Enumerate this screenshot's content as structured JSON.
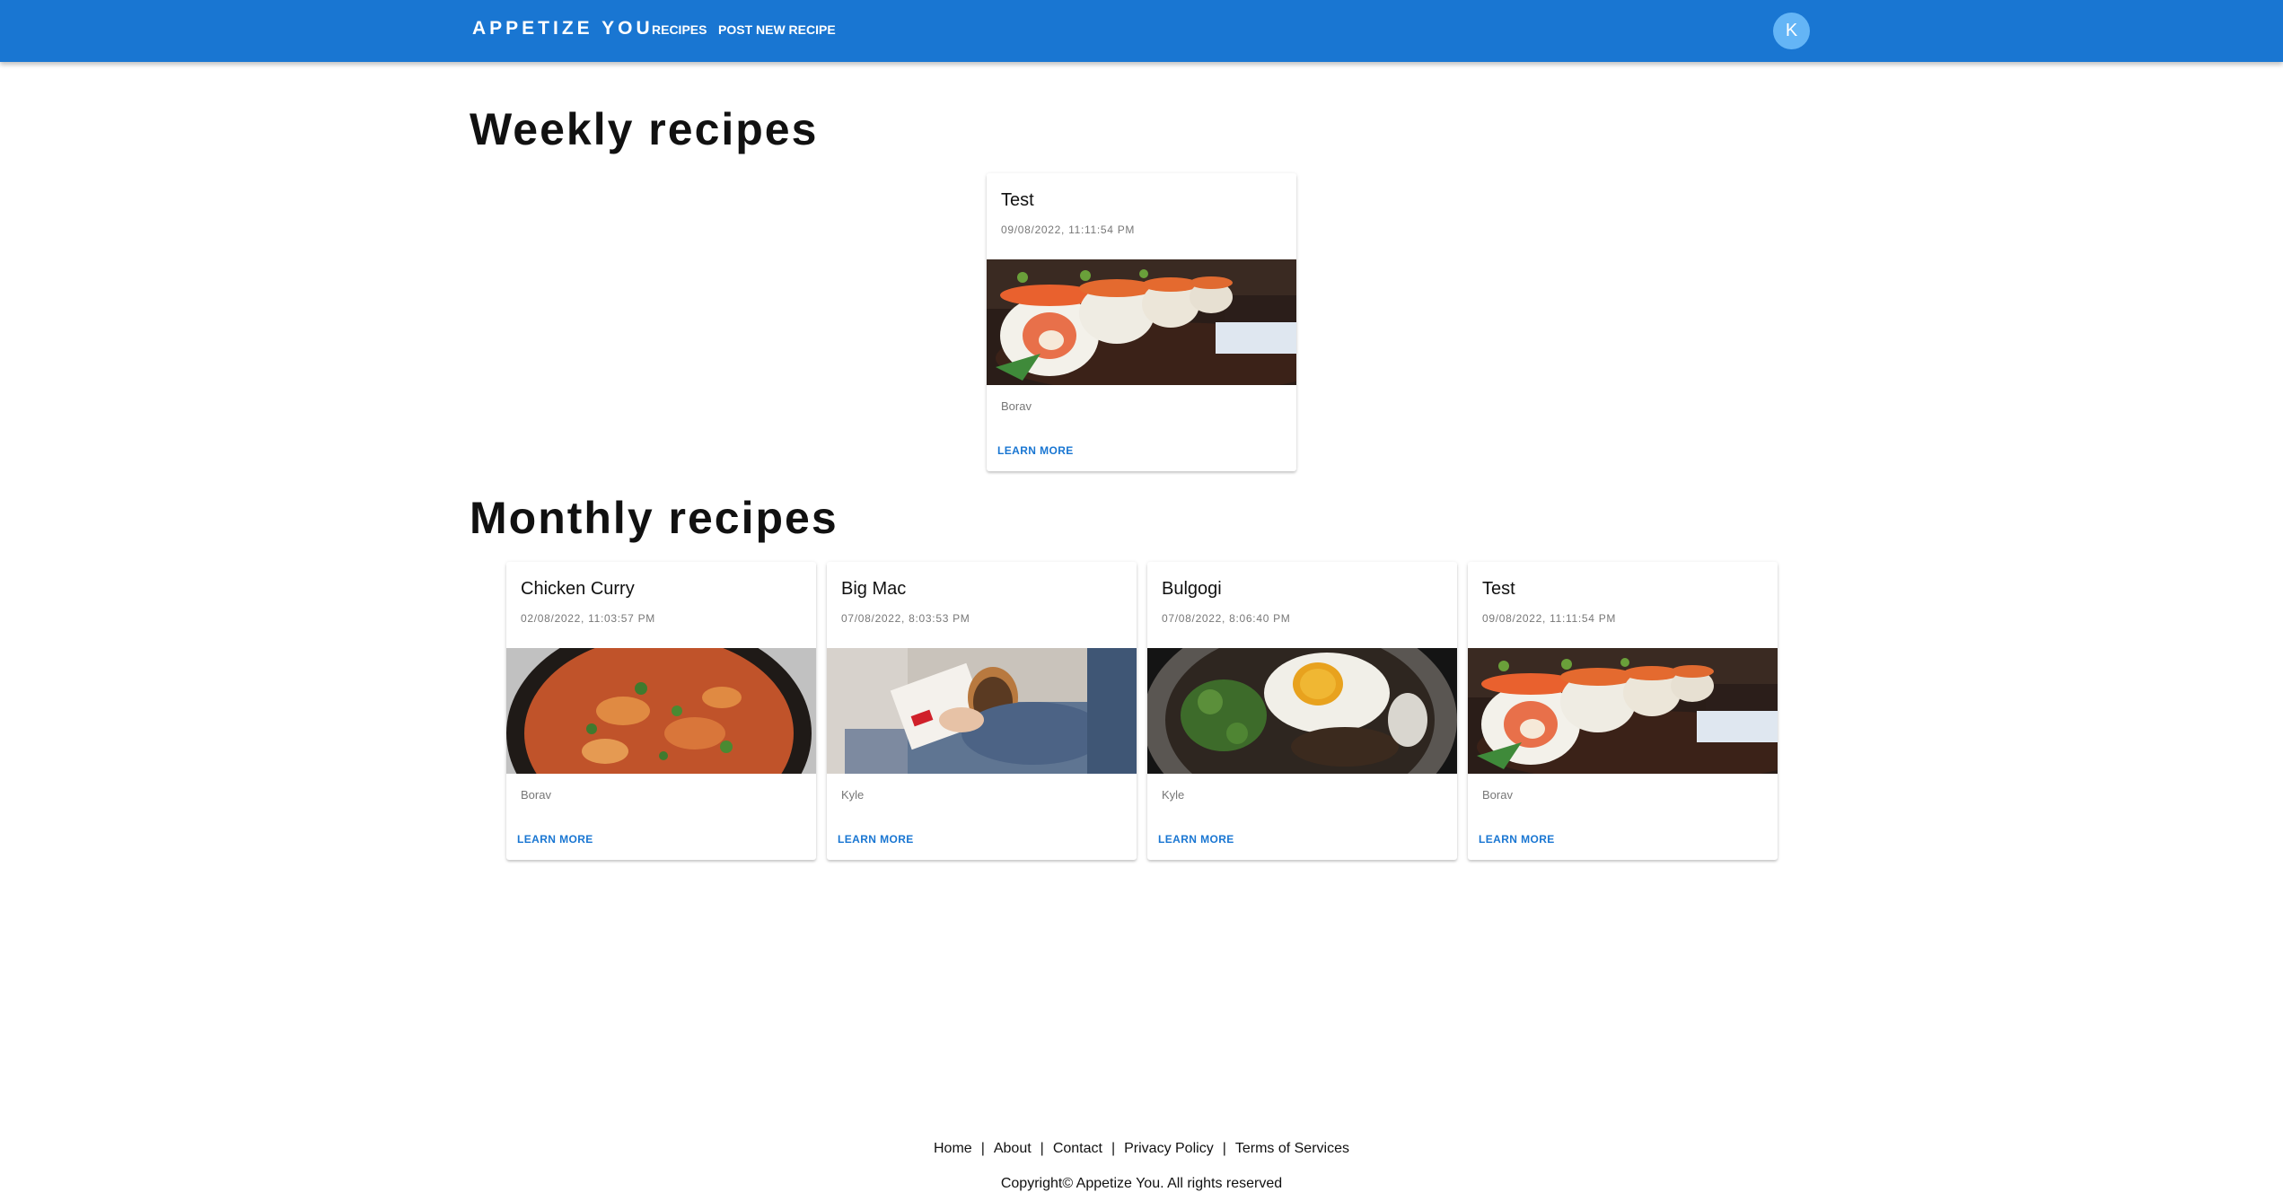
{
  "header": {
    "brand": "APPETIZE YOU",
    "nav": [
      "RECIPES",
      "POST NEW RECIPE"
    ],
    "avatar_initial": "K"
  },
  "weekly": {
    "title": "Weekly recipes",
    "cards": [
      {
        "title": "Test",
        "date": "09/08/2022, 11:11:54 PM",
        "author": "Borav",
        "action": "LEARN MORE",
        "image": "sushi-rolls-photo"
      }
    ]
  },
  "monthly": {
    "title": "Monthly recipes",
    "cards": [
      {
        "title": "Chicken Curry",
        "date": "02/08/2022, 11:03:57 PM",
        "author": "Borav",
        "action": "LEARN MORE",
        "image": "chicken-curry-photo"
      },
      {
        "title": "Big Mac",
        "date": "07/08/2022, 8:03:53 PM",
        "author": "Kyle",
        "action": "LEARN MORE",
        "image": "burger-box-photo"
      },
      {
        "title": "Bulgogi",
        "date": "07/08/2022, 8:06:40 PM",
        "author": "Kyle",
        "action": "LEARN MORE",
        "image": "bulgogi-bowl-photo"
      },
      {
        "title": "Test",
        "date": "09/08/2022, 11:11:54 PM",
        "author": "Borav",
        "action": "LEARN MORE",
        "image": "sushi-rolls-photo"
      }
    ]
  },
  "footer": {
    "links": [
      "Home",
      "About",
      "Contact",
      "Privacy Policy",
      "Terms of Services"
    ],
    "copyright": "Copyright© Appetize You. All rights reserved"
  },
  "colors": {
    "primary": "#1976d2",
    "avatar": "#64b5f6"
  }
}
